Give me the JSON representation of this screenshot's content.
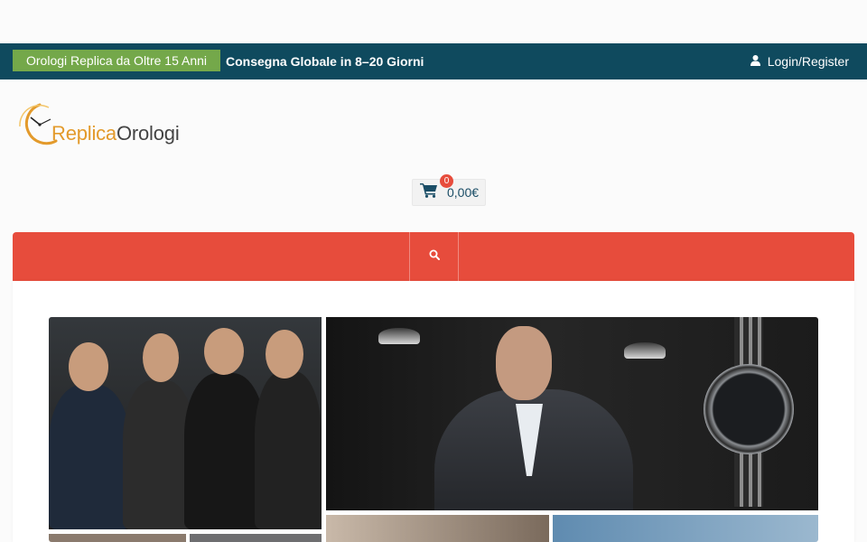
{
  "topbar": {
    "badge": "Orologi Replica da Oltre 15 Anni",
    "shipping": "Consegna Globale in 8–20 Giorni",
    "login": "Login/Register"
  },
  "logo": {
    "word1": "Replica",
    "word2": "Orologi"
  },
  "cart": {
    "count": "0",
    "total": "0,00€"
  },
  "colors": {
    "topbar": "#0f4a5e",
    "badge": "#74a84a",
    "nav": "#e74c3c",
    "logo_accent": "#e39a2b"
  },
  "icons": [
    "user-icon",
    "cart-icon",
    "search-icon",
    "clock-logo-icon"
  ]
}
